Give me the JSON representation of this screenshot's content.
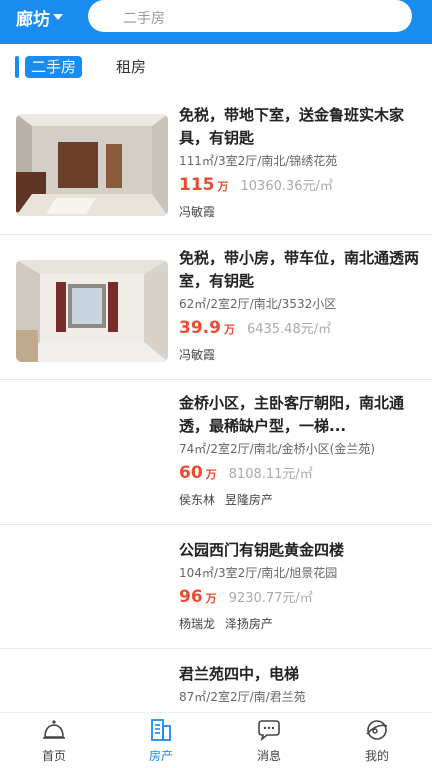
{
  "header": {
    "city": "廊坊",
    "search_placeholder": "二手房"
  },
  "tabs": [
    {
      "label": "二手房",
      "active": true
    },
    {
      "label": "租房",
      "active": false
    }
  ],
  "listings": [
    {
      "title": "免税，带地下室，送金鲁班实木家具，有钥匙",
      "meta": "111㎡/3室2厅/南北/锦绣花苑",
      "price": "115",
      "price_unit": "万",
      "unit_price": "10360.36元/㎡",
      "agent": "冯敏霞",
      "agency": ""
    },
    {
      "title": "免税，带小房，带车位，南北通透两室，有钥匙",
      "meta": "62㎡/2室2厅/南北/3532小区",
      "price": "39.9",
      "price_unit": "万",
      "unit_price": "6435.48元/㎡",
      "agent": "冯敏霞",
      "agency": ""
    },
    {
      "title": "金桥小区，主卧客厅朝阳，南北通透，最稀缺户型，一梯...",
      "meta": "74㎡/2室2厅/南北/金桥小区(金兰苑)",
      "price": "60",
      "price_unit": "万",
      "unit_price": "8108.11元/㎡",
      "agent": "侯东林",
      "agency": "昱隆房产"
    },
    {
      "title": "公园西门有钥匙黄金四楼",
      "meta": "104㎡/3室2厅/南北/旭景花园",
      "price": "96",
      "price_unit": "万",
      "unit_price": "9230.77元/㎡",
      "agent": "杨瑞龙",
      "agency": "泽扬房产"
    },
    {
      "title": "君兰苑四中，电梯",
      "meta": "87㎡/2室2厅/南/君兰苑",
      "price": "",
      "price_unit": "",
      "unit_price": "",
      "agent": "",
      "agency": ""
    }
  ],
  "bottom_nav": [
    {
      "label": "首页",
      "icon": "home-icon",
      "active": false
    },
    {
      "label": "房产",
      "icon": "building-icon",
      "active": true
    },
    {
      "label": "消息",
      "icon": "message-icon",
      "active": false
    },
    {
      "label": "我的",
      "icon": "profile-icon",
      "active": false
    }
  ],
  "colors": {
    "accent": "#1a8cf0",
    "price": "#ee4a2e"
  }
}
